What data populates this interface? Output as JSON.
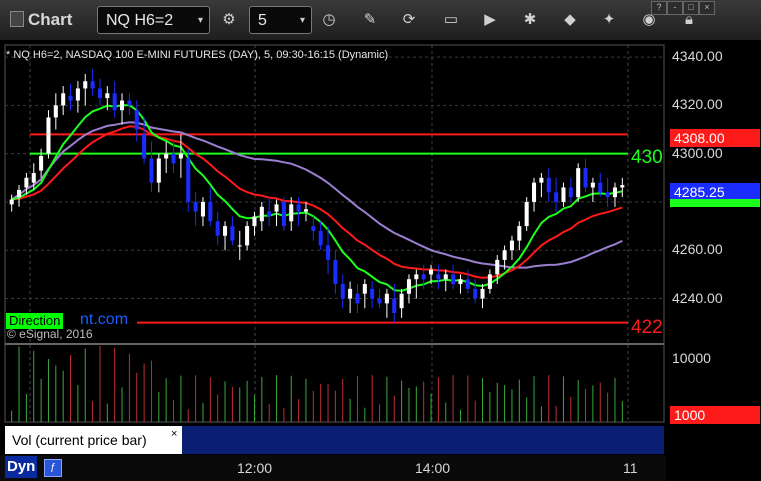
{
  "toolbar": {
    "title": "Chart",
    "symbol": "NQ H6=2",
    "interval": "5",
    "icons": [
      "clock-icon",
      "pencil-icon",
      "cursor-icon",
      "study-icon",
      "play-icon",
      "settings-icon",
      "tag-icon",
      "pin-icon",
      "eye-icon",
      "lock-icon"
    ]
  },
  "window_controls": [
    "?",
    "-",
    "□",
    "×"
  ],
  "chart_header": "* NQ H6=2, NASDAQ 100 E-MINI FUTURES (DAY), 5, 09:30-16:15 (Dynamic)",
  "copyright": "© eSignal, 2016",
  "watermark": {
    "label": "Direction",
    "url": "nt.com"
  },
  "price_labels": {
    "red_tag": "4308.00",
    "last_tag": "4285.25",
    "green_line_text": "430",
    "red_line_text": "422",
    "volume_tag": "1000"
  },
  "colors": {
    "up": "#ffffff",
    "down": "#1a2cff",
    "red": "#ff1a1a",
    "green": "#1dff1d",
    "purple": "#9b7fd0"
  },
  "volume_panel": {
    "label": "Vol (current price bar)",
    "close": "×",
    "y_label": "10000"
  },
  "status": {
    "mode": "Dyn"
  },
  "time_axis": [
    "12:00",
    "14:00",
    "11"
  ],
  "chart_data": {
    "type": "candlestick",
    "ylim": [
      4222,
      4345
    ],
    "yticks": [
      "4340.00",
      "4320.00",
      "4300.00",
      "4280.00",
      "4260.00",
      "4240.00"
    ],
    "horizontal_lines": [
      4308,
      4300,
      4230
    ],
    "candles": [
      [
        4279,
        4283,
        4276,
        4281
      ],
      [
        4282,
        4287,
        4278,
        4285
      ],
      [
        4286,
        4292,
        4283,
        4290
      ],
      [
        4288,
        4296,
        4285,
        4292
      ],
      [
        4293,
        4302,
        4290,
        4299
      ],
      [
        4300,
        4318,
        4298,
        4315
      ],
      [
        4315,
        4325,
        4310,
        4320
      ],
      [
        4320,
        4328,
        4316,
        4325
      ],
      [
        4324,
        4329,
        4318,
        4322
      ],
      [
        4322,
        4330,
        4317,
        4327
      ],
      [
        4327,
        4333,
        4320,
        4330
      ],
      [
        4330,
        4335,
        4324,
        4327
      ],
      [
        4327,
        4331,
        4320,
        4323
      ],
      [
        4323,
        4328,
        4318,
        4325
      ],
      [
        4325,
        4330,
        4315,
        4318
      ],
      [
        4318,
        4325,
        4312,
        4322
      ],
      [
        4322,
        4325,
        4316,
        4320
      ],
      [
        4318,
        4322,
        4305,
        4310
      ],
      [
        4308,
        4315,
        4296,
        4298
      ],
      [
        4298,
        4305,
        4284,
        4288
      ],
      [
        4288,
        4300,
        4284,
        4298
      ],
      [
        4298,
        4305,
        4292,
        4300
      ],
      [
        4300,
        4306,
        4292,
        4296
      ],
      [
        4298,
        4308,
        4290,
        4300
      ],
      [
        4298,
        4302,
        4276,
        4280
      ],
      [
        4280,
        4284,
        4270,
        4276
      ],
      [
        4274,
        4282,
        4270,
        4280
      ],
      [
        4280,
        4286,
        4270,
        4272
      ],
      [
        4272,
        4276,
        4262,
        4266
      ],
      [
        4266,
        4272,
        4260,
        4270
      ],
      [
        4270,
        4274,
        4262,
        4264
      ],
      [
        4262,
        4268,
        4256,
        4262
      ],
      [
        4262,
        4272,
        4260,
        4270
      ],
      [
        4270,
        4276,
        4266,
        4274
      ],
      [
        4272,
        4280,
        4268,
        4278
      ],
      [
        4276,
        4282,
        4270,
        4274
      ],
      [
        4276,
        4281,
        4270,
        4279
      ],
      [
        4280,
        4282,
        4268,
        4270
      ],
      [
        4272,
        4282,
        4268,
        4279
      ],
      [
        4279,
        4282,
        4270,
        4276
      ],
      [
        4276,
        4280,
        4272,
        4277
      ],
      [
        4270,
        4274,
        4264,
        4268
      ],
      [
        4268,
        4272,
        4260,
        4262
      ],
      [
        4262,
        4270,
        4250,
        4256
      ],
      [
        4256,
        4260,
        4242,
        4246
      ],
      [
        4246,
        4250,
        4236,
        4240
      ],
      [
        4240,
        4247,
        4234,
        4244
      ],
      [
        4242,
        4246,
        4234,
        4238
      ],
      [
        4242,
        4248,
        4236,
        4246
      ],
      [
        4244,
        4247,
        4236,
        4240
      ],
      [
        4240,
        4244,
        4236,
        4238
      ],
      [
        4238,
        4244,
        4232,
        4242
      ],
      [
        4240,
        4246,
        4230,
        4234
      ],
      [
        4236,
        4244,
        4232,
        4242
      ],
      [
        4242,
        4250,
        4238,
        4248
      ],
      [
        4248,
        4252,
        4240,
        4250
      ],
      [
        4250,
        4254,
        4244,
        4248
      ],
      [
        4250,
        4254,
        4246,
        4252
      ],
      [
        4250,
        4254,
        4244,
        4248
      ],
      [
        4248,
        4252,
        4243,
        4250
      ],
      [
        4250,
        4254,
        4244,
        4246
      ],
      [
        4246,
        4250,
        4242,
        4248
      ],
      [
        4248,
        4252,
        4242,
        4244
      ],
      [
        4244,
        4248,
        4238,
        4240
      ],
      [
        4240,
        4246,
        4236,
        4244
      ],
      [
        4244,
        4252,
        4242,
        4250
      ],
      [
        4250,
        4258,
        4246,
        4256
      ],
      [
        4256,
        4262,
        4252,
        4260
      ],
      [
        4260,
        4266,
        4256,
        4264
      ],
      [
        4264,
        4272,
        4260,
        4270
      ],
      [
        4270,
        4282,
        4268,
        4280
      ],
      [
        4280,
        4290,
        4276,
        4288
      ],
      [
        4288,
        4292,
        4282,
        4290
      ],
      [
        4290,
        4294,
        4280,
        4284
      ],
      [
        4284,
        4290,
        4276,
        4280
      ],
      [
        4280,
        4288,
        4278,
        4286
      ],
      [
        4286,
        4290,
        4280,
        4282
      ],
      [
        4282,
        4296,
        4280,
        4294
      ],
      [
        4294,
        4298,
        4284,
        4286
      ],
      [
        4286,
        4290,
        4280,
        4288
      ],
      [
        4288,
        4292,
        4282,
        4284
      ],
      [
        4284,
        4290,
        4278,
        4282
      ],
      [
        4282,
        4288,
        4278,
        4286
      ],
      [
        4286,
        4290,
        4282,
        4287
      ]
    ],
    "volume_ylim": [
      0,
      10000
    ]
  }
}
